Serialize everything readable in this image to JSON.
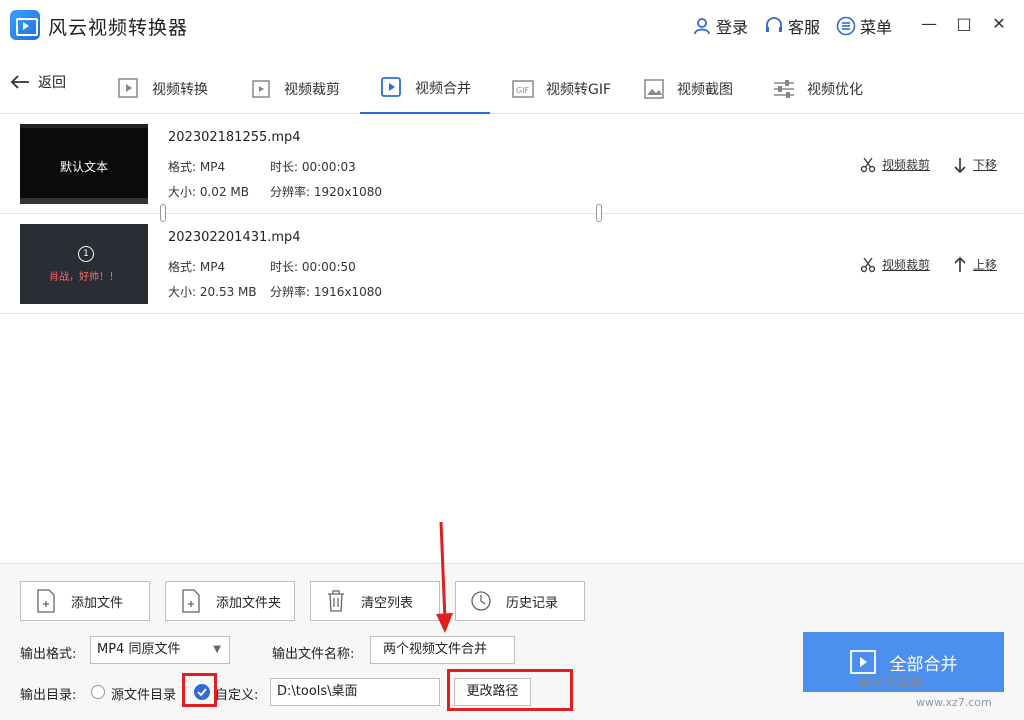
{
  "app": {
    "title": "风云视频转换器"
  },
  "titlebar": {
    "login": "登录",
    "service": "客服",
    "menu": "菜单"
  },
  "nav": {
    "back": "返回",
    "tabs": [
      {
        "label": "视频转换",
        "icon": "video-convert-icon"
      },
      {
        "label": "视频裁剪",
        "icon": "video-crop-icon"
      },
      {
        "label": "视频合并",
        "icon": "video-merge-icon",
        "active": true
      },
      {
        "label": "视频转GIF",
        "icon": "gif-icon"
      },
      {
        "label": "视频截图",
        "icon": "screenshot-icon"
      },
      {
        "label": "视频优化",
        "icon": "optimize-icon"
      }
    ]
  },
  "files": [
    {
      "name": "202302181255.mp4",
      "format": "格式: MP4",
      "duration": "时长: 00:00:03",
      "size": "大小: 0.02 MB",
      "resolution": "分辨率: 1920x1080",
      "thumb_text": "默认文本",
      "crop": "视频裁剪",
      "move": "下移"
    },
    {
      "name": "202302201431.mp4",
      "format": "格式: MP4",
      "duration": "时长: 00:00:50",
      "size": "大小: 20.53 MB",
      "resolution": "分辨率: 1916x1080",
      "thumb_text": "肖战，好帅！！",
      "thumb_num": "1",
      "crop": "视频裁剪",
      "move": "上移"
    }
  ],
  "toolbar": {
    "add_file": "添加文件",
    "add_folder": "添加文件夹",
    "clear_list": "清空列表",
    "history": "历史记录"
  },
  "output": {
    "format_label": "输出格式:",
    "format_value": "MP4 同原文件",
    "name_label": "输出文件名称:",
    "name_value": "两个视频文件合并",
    "dir_label": "输出目录:",
    "source_dir": "源文件目录",
    "custom": "自定义:",
    "path_value": "D:\\tools\\桌面",
    "change_path": "更改路径"
  },
  "merge_all": "全部合并",
  "watermark": {
    "brand": "极光下载站",
    "url": "www.xz7.com"
  },
  "colors": {
    "accent": "#2e6bd6",
    "merge_button": "#4d8fef",
    "highlight": "#e02020"
  }
}
